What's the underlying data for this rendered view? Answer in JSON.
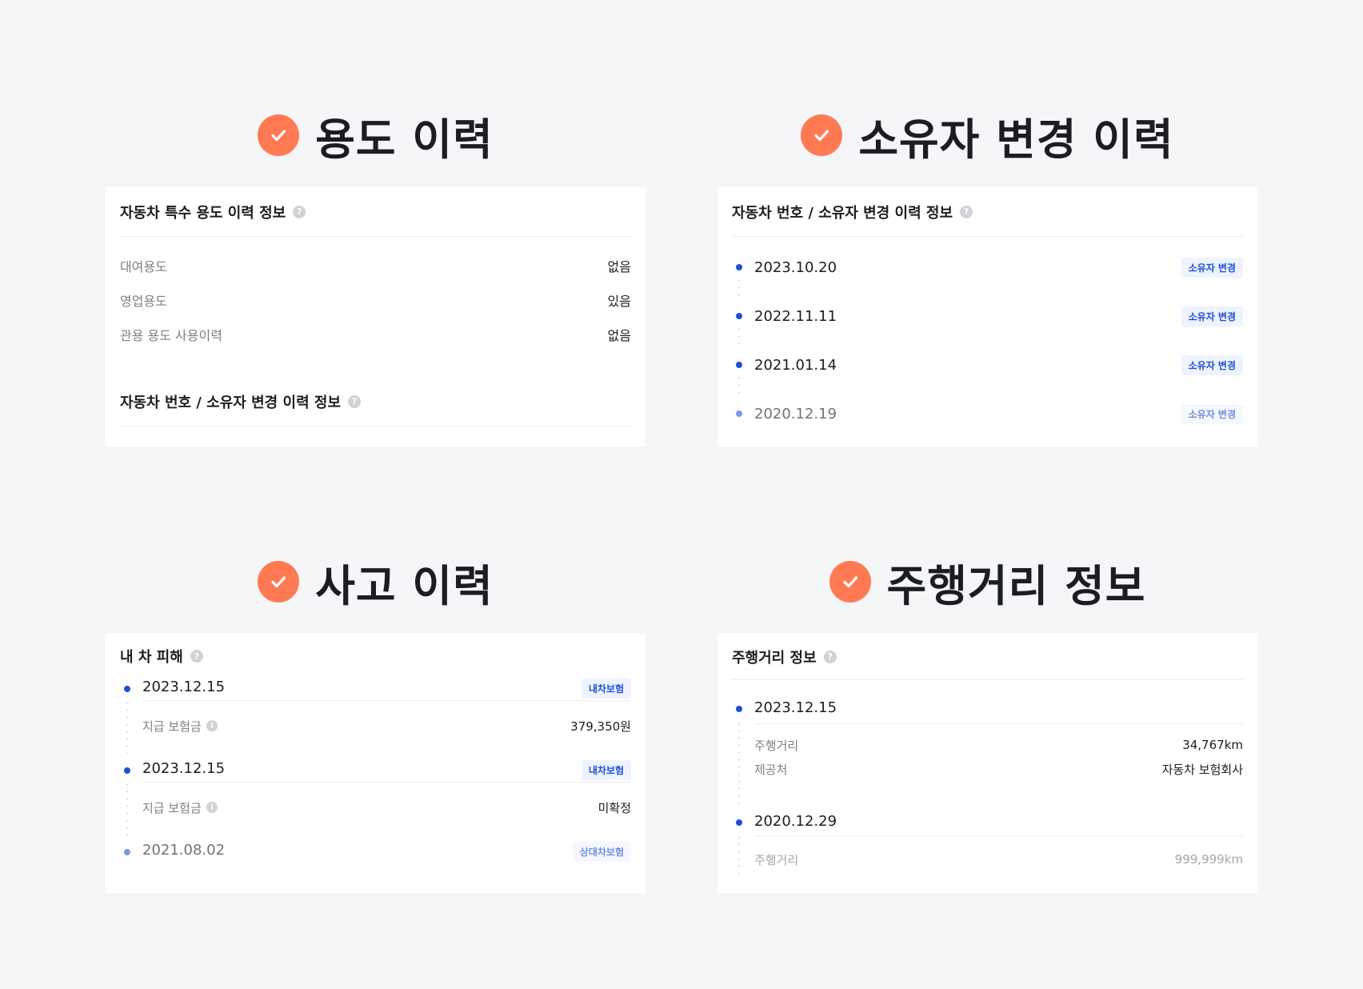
{
  "usage": {
    "title": "용도 이력",
    "card_title": "자동차 특수 용도 이력 정보",
    "rows": [
      {
        "label": "대여용도",
        "value": "없음"
      },
      {
        "label": "영업용도",
        "value": "있음"
      },
      {
        "label": "관용 용도 사용이력",
        "value": "없음"
      }
    ],
    "sub_title": "자동차 번호 / 소유자 변경 이력 정보"
  },
  "owner": {
    "title": "소유자 변경 이력",
    "card_title": "자동차 번호 / 소유자 변경 이력 정보",
    "items": [
      {
        "date": "2023.10.20",
        "badge": "소유자 변경"
      },
      {
        "date": "2022.11.11",
        "badge": "소유자 변경"
      },
      {
        "date": "2021.01.14",
        "badge": "소유자 변경"
      },
      {
        "date": "2020.12.19",
        "badge": "소유자 변경"
      }
    ]
  },
  "accident": {
    "title": "사고 이력",
    "card_title": "내 차 피해",
    "items": [
      {
        "date": "2023.12.15",
        "badge": "내차보험",
        "label": "지급 보험금",
        "value": "379,350원"
      },
      {
        "date": "2023.12.15",
        "badge": "내차보험",
        "label": "지급 보험금",
        "value": "미확정"
      },
      {
        "date": "2021.08.02",
        "badge": "상대차보험"
      }
    ]
  },
  "mileage": {
    "title": "주행거리 정보",
    "card_title": "주행거리 정보",
    "items": [
      {
        "date": "2023.12.15",
        "rows": [
          {
            "label": "주행거리",
            "value": "34,767km"
          },
          {
            "label": "제공처",
            "value": "자동차 보험회사"
          }
        ]
      },
      {
        "date": "2020.12.29",
        "rows": [
          {
            "label": "주행거리",
            "value": "999,999km"
          }
        ]
      }
    ]
  },
  "icons": {
    "check": "check-circle-icon",
    "help": "question-circle-icon",
    "info": "info-icon",
    "timeline": "timeline-dot-icon"
  },
  "colors": {
    "accent": "#ff7a52",
    "primary": "#1d4fd8",
    "badge_bg": "#eef3ff",
    "background": "#f5f6f8"
  }
}
